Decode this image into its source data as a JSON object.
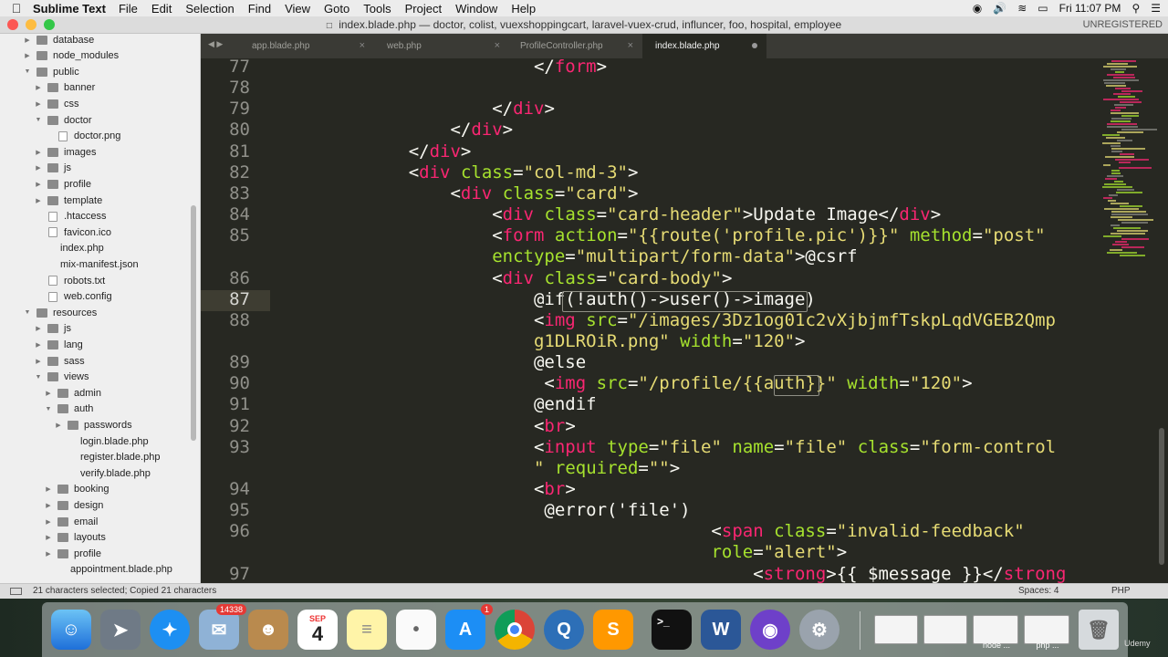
{
  "menubar": {
    "app_name": "Sublime Text",
    "items": [
      "File",
      "Edit",
      "Selection",
      "Find",
      "View",
      "Goto",
      "Tools",
      "Project",
      "Window",
      "Help"
    ],
    "clock": "Fri 11:07 PM"
  },
  "window": {
    "title": "index.blade.php — doctor, colist, vuexshoppingcart, laravel-vuex-crud, influncer, foo, hospital, employee",
    "unregistered": "UNREGISTERED"
  },
  "sidebar": {
    "items": [
      {
        "label": "database",
        "type": "folder",
        "level": 1,
        "state": "closed"
      },
      {
        "label": "node_modules",
        "type": "folder",
        "level": 1,
        "state": "closed"
      },
      {
        "label": "public",
        "type": "folder",
        "level": 1,
        "state": "open"
      },
      {
        "label": "banner",
        "type": "folder",
        "level": 2,
        "state": "closed"
      },
      {
        "label": "css",
        "type": "folder",
        "level": 2,
        "state": "closed"
      },
      {
        "label": "doctor",
        "type": "folder",
        "level": 2,
        "state": "open"
      },
      {
        "label": "doctor.png",
        "type": "file",
        "level": 3
      },
      {
        "label": "images",
        "type": "folder",
        "level": 2,
        "state": "closed"
      },
      {
        "label": "js",
        "type": "folder",
        "level": 2,
        "state": "closed"
      },
      {
        "label": "profile",
        "type": "folder",
        "level": 2,
        "state": "closed"
      },
      {
        "label": "template",
        "type": "folder",
        "level": 2,
        "state": "closed"
      },
      {
        "label": ".htaccess",
        "type": "file",
        "level": 2
      },
      {
        "label": "favicon.ico",
        "type": "file",
        "level": 2
      },
      {
        "label": "index.php",
        "type": "plain",
        "level": 2
      },
      {
        "label": "mix-manifest.json",
        "type": "plain",
        "level": 2
      },
      {
        "label": "robots.txt",
        "type": "file",
        "level": 2
      },
      {
        "label": "web.config",
        "type": "file",
        "level": 2
      },
      {
        "label": "resources",
        "type": "folder",
        "level": 1,
        "state": "open"
      },
      {
        "label": "js",
        "type": "folder",
        "level": 2,
        "state": "closed"
      },
      {
        "label": "lang",
        "type": "folder",
        "level": 2,
        "state": "closed"
      },
      {
        "label": "sass",
        "type": "folder",
        "level": 2,
        "state": "closed"
      },
      {
        "label": "views",
        "type": "folder",
        "level": 2,
        "state": "open"
      },
      {
        "label": "admin",
        "type": "folder",
        "level": 3,
        "state": "closed"
      },
      {
        "label": "auth",
        "type": "folder",
        "level": 3,
        "state": "open"
      },
      {
        "label": "passwords",
        "type": "folder",
        "level": 4,
        "state": "closed"
      },
      {
        "label": "login.blade.php",
        "type": "plain",
        "level": 4
      },
      {
        "label": "register.blade.php",
        "type": "plain",
        "level": 4
      },
      {
        "label": "verify.blade.php",
        "type": "plain",
        "level": 4
      },
      {
        "label": "booking",
        "type": "folder",
        "level": 3,
        "state": "closed"
      },
      {
        "label": "design",
        "type": "folder",
        "level": 3,
        "state": "closed"
      },
      {
        "label": "email",
        "type": "folder",
        "level": 3,
        "state": "closed"
      },
      {
        "label": "layouts",
        "type": "folder",
        "level": 3,
        "state": "closed"
      },
      {
        "label": "profile",
        "type": "folder",
        "level": 3,
        "state": "closed"
      },
      {
        "label": "appointment.blade.php",
        "type": "plain",
        "level": 3
      }
    ]
  },
  "tabs": [
    {
      "label": "app.blade.php",
      "active": false
    },
    {
      "label": "web.php",
      "active": false
    },
    {
      "label": "ProfileController.php",
      "active": false
    },
    {
      "label": "index.blade.php",
      "active": true
    }
  ],
  "editor": {
    "current_line": "87",
    "lines": [
      {
        "num": "77",
        "segs": [
          {
            "c": "p",
            "t": "                         </"
          },
          {
            "c": "t",
            "t": "form"
          },
          {
            "c": "p",
            "t": ">"
          }
        ]
      },
      {
        "num": "78",
        "segs": [
          {
            "c": "p",
            "t": ""
          }
        ]
      },
      {
        "num": "79",
        "segs": [
          {
            "c": "p",
            "t": "                     </"
          },
          {
            "c": "t",
            "t": "div"
          },
          {
            "c": "p",
            "t": ">"
          }
        ]
      },
      {
        "num": "80",
        "segs": [
          {
            "c": "p",
            "t": "                 </"
          },
          {
            "c": "t",
            "t": "div"
          },
          {
            "c": "p",
            "t": ">"
          }
        ]
      },
      {
        "num": "81",
        "segs": [
          {
            "c": "p",
            "t": "             </"
          },
          {
            "c": "t",
            "t": "div"
          },
          {
            "c": "p",
            "t": ">"
          }
        ]
      },
      {
        "num": "82",
        "segs": [
          {
            "c": "p",
            "t": "             <"
          },
          {
            "c": "t",
            "t": "div"
          },
          {
            "c": "p",
            "t": " "
          },
          {
            "c": "a",
            "t": "class"
          },
          {
            "c": "p",
            "t": "="
          },
          {
            "c": "s",
            "t": "\"col-md-3\""
          },
          {
            "c": "p",
            "t": ">"
          }
        ]
      },
      {
        "num": "83",
        "segs": [
          {
            "c": "p",
            "t": "                 <"
          },
          {
            "c": "t",
            "t": "div"
          },
          {
            "c": "p",
            "t": " "
          },
          {
            "c": "a",
            "t": "class"
          },
          {
            "c": "p",
            "t": "="
          },
          {
            "c": "s",
            "t": "\"card\""
          },
          {
            "c": "p",
            "t": ">"
          }
        ]
      },
      {
        "num": "84",
        "segs": [
          {
            "c": "p",
            "t": "                     <"
          },
          {
            "c": "t",
            "t": "div"
          },
          {
            "c": "p",
            "t": " "
          },
          {
            "c": "a",
            "t": "class"
          },
          {
            "c": "p",
            "t": "="
          },
          {
            "c": "s",
            "t": "\"card-header\""
          },
          {
            "c": "p",
            "t": ">Update Image</"
          },
          {
            "c": "t",
            "t": "div"
          },
          {
            "c": "p",
            "t": ">"
          }
        ]
      },
      {
        "num": "85",
        "segs": [
          {
            "c": "p",
            "t": "                     <"
          },
          {
            "c": "t",
            "t": "form"
          },
          {
            "c": "p",
            "t": " "
          },
          {
            "c": "a",
            "t": "action"
          },
          {
            "c": "p",
            "t": "="
          },
          {
            "c": "s",
            "t": "\"{{route('profile.pic')}}\""
          },
          {
            "c": "p",
            "t": " "
          },
          {
            "c": "a",
            "t": "method"
          },
          {
            "c": "p",
            "t": "="
          },
          {
            "c": "s",
            "t": "\"post\""
          }
        ]
      },
      {
        "num": "",
        "segs": [
          {
            "c": "p",
            "t": "                     "
          },
          {
            "c": "a",
            "t": "enctype"
          },
          {
            "c": "p",
            "t": "="
          },
          {
            "c": "s",
            "t": "\"multipart/form-data\""
          },
          {
            "c": "p",
            "t": ">@csrf"
          }
        ]
      },
      {
        "num": "86",
        "segs": [
          {
            "c": "p",
            "t": "                     <"
          },
          {
            "c": "t",
            "t": "div"
          },
          {
            "c": "p",
            "t": " "
          },
          {
            "c": "a",
            "t": "class"
          },
          {
            "c": "p",
            "t": "="
          },
          {
            "c": "s",
            "t": "\"card-body\""
          },
          {
            "c": "p",
            "t": ">"
          }
        ]
      },
      {
        "num": "87",
        "segs": [
          {
            "c": "p",
            "t": "                         @if(!auth()->user()->image)"
          }
        ]
      },
      {
        "num": "88",
        "segs": [
          {
            "c": "p",
            "t": "                         <"
          },
          {
            "c": "t",
            "t": "img"
          },
          {
            "c": "p",
            "t": " "
          },
          {
            "c": "a",
            "t": "src"
          },
          {
            "c": "p",
            "t": "="
          },
          {
            "c": "s",
            "t": "\"/images/3Dz1og01c2vXjbjmfTskpLqdVGEB2Qmp"
          }
        ]
      },
      {
        "num": "",
        "segs": [
          {
            "c": "p",
            "t": "                         "
          },
          {
            "c": "s",
            "t": "g1DLROiR.png\""
          },
          {
            "c": "p",
            "t": " "
          },
          {
            "c": "a",
            "t": "width"
          },
          {
            "c": "p",
            "t": "="
          },
          {
            "c": "s",
            "t": "\"120\""
          },
          {
            "c": "p",
            "t": ">"
          }
        ]
      },
      {
        "num": "89",
        "segs": [
          {
            "c": "p",
            "t": "                         @else"
          }
        ]
      },
      {
        "num": "90",
        "segs": [
          {
            "c": "p",
            "t": "                          <"
          },
          {
            "c": "t",
            "t": "img"
          },
          {
            "c": "p",
            "t": " "
          },
          {
            "c": "a",
            "t": "src"
          },
          {
            "c": "p",
            "t": "="
          },
          {
            "c": "s",
            "t": "\"/profile/{{auth}}\""
          },
          {
            "c": "p",
            "t": " "
          },
          {
            "c": "a",
            "t": "width"
          },
          {
            "c": "p",
            "t": "="
          },
          {
            "c": "s",
            "t": "\"120\""
          },
          {
            "c": "p",
            "t": ">"
          }
        ]
      },
      {
        "num": "91",
        "segs": [
          {
            "c": "p",
            "t": "                         @endif"
          }
        ]
      },
      {
        "num": "92",
        "segs": [
          {
            "c": "p",
            "t": "                         <"
          },
          {
            "c": "t",
            "t": "br"
          },
          {
            "c": "p",
            "t": ">"
          }
        ]
      },
      {
        "num": "93",
        "segs": [
          {
            "c": "p",
            "t": "                         <"
          },
          {
            "c": "t",
            "t": "input"
          },
          {
            "c": "p",
            "t": " "
          },
          {
            "c": "a",
            "t": "type"
          },
          {
            "c": "p",
            "t": "="
          },
          {
            "c": "s",
            "t": "\"file\""
          },
          {
            "c": "p",
            "t": " "
          },
          {
            "c": "a",
            "t": "name"
          },
          {
            "c": "p",
            "t": "="
          },
          {
            "c": "s",
            "t": "\"file\""
          },
          {
            "c": "p",
            "t": " "
          },
          {
            "c": "a",
            "t": "class"
          },
          {
            "c": "p",
            "t": "="
          },
          {
            "c": "s",
            "t": "\"form-control"
          }
        ]
      },
      {
        "num": "",
        "segs": [
          {
            "c": "p",
            "t": "                         "
          },
          {
            "c": "s",
            "t": "\""
          },
          {
            "c": "p",
            "t": " "
          },
          {
            "c": "a",
            "t": "required"
          },
          {
            "c": "p",
            "t": "="
          },
          {
            "c": "s",
            "t": "\"\""
          },
          {
            "c": "p",
            "t": ">"
          }
        ]
      },
      {
        "num": "94",
        "segs": [
          {
            "c": "p",
            "t": "                         <"
          },
          {
            "c": "t",
            "t": "br"
          },
          {
            "c": "p",
            "t": ">"
          }
        ]
      },
      {
        "num": "95",
        "segs": [
          {
            "c": "p",
            "t": "                          @error('file')"
          }
        ]
      },
      {
        "num": "96",
        "segs": [
          {
            "c": "p",
            "t": "                                          <"
          },
          {
            "c": "t",
            "t": "span"
          },
          {
            "c": "p",
            "t": " "
          },
          {
            "c": "a",
            "t": "class"
          },
          {
            "c": "p",
            "t": "="
          },
          {
            "c": "s",
            "t": "\"invalid-feedback\""
          }
        ]
      },
      {
        "num": "",
        "segs": [
          {
            "c": "p",
            "t": "                                          "
          },
          {
            "c": "a",
            "t": "role"
          },
          {
            "c": "p",
            "t": "="
          },
          {
            "c": "s",
            "t": "\"alert\""
          },
          {
            "c": "p",
            "t": ">"
          }
        ]
      },
      {
        "num": "97",
        "segs": [
          {
            "c": "p",
            "t": "                                              <"
          },
          {
            "c": "t",
            "t": "strong"
          },
          {
            "c": "p",
            "t": ">{{ $message }}</"
          },
          {
            "c": "t",
            "t": "strong"
          }
        ]
      }
    ]
  },
  "status": {
    "text": "21 characters selected; Copied 21 characters",
    "spaces": "Spaces: 4",
    "syntax": "PHP"
  },
  "dock": {
    "mail_badge": "14338",
    "calendar_month": "SEP",
    "calendar_day": "4",
    "appstore_badge": "1",
    "thumb_labels": [
      "node ...",
      "php ..."
    ]
  },
  "watermark": "Udemy",
  "colors": {
    "editor_bg": "#272822",
    "tag": "#f92672",
    "attr": "#a6e22e",
    "string": "#e6db74",
    "plain": "#f8f8f2",
    "gutter": "#90908a"
  },
  "icons": [
    "apple-icon",
    "search-icon",
    "wifi-icon",
    "volume-icon",
    "battery-icon",
    "folder-icon",
    "file-icon",
    "close-icon"
  ]
}
